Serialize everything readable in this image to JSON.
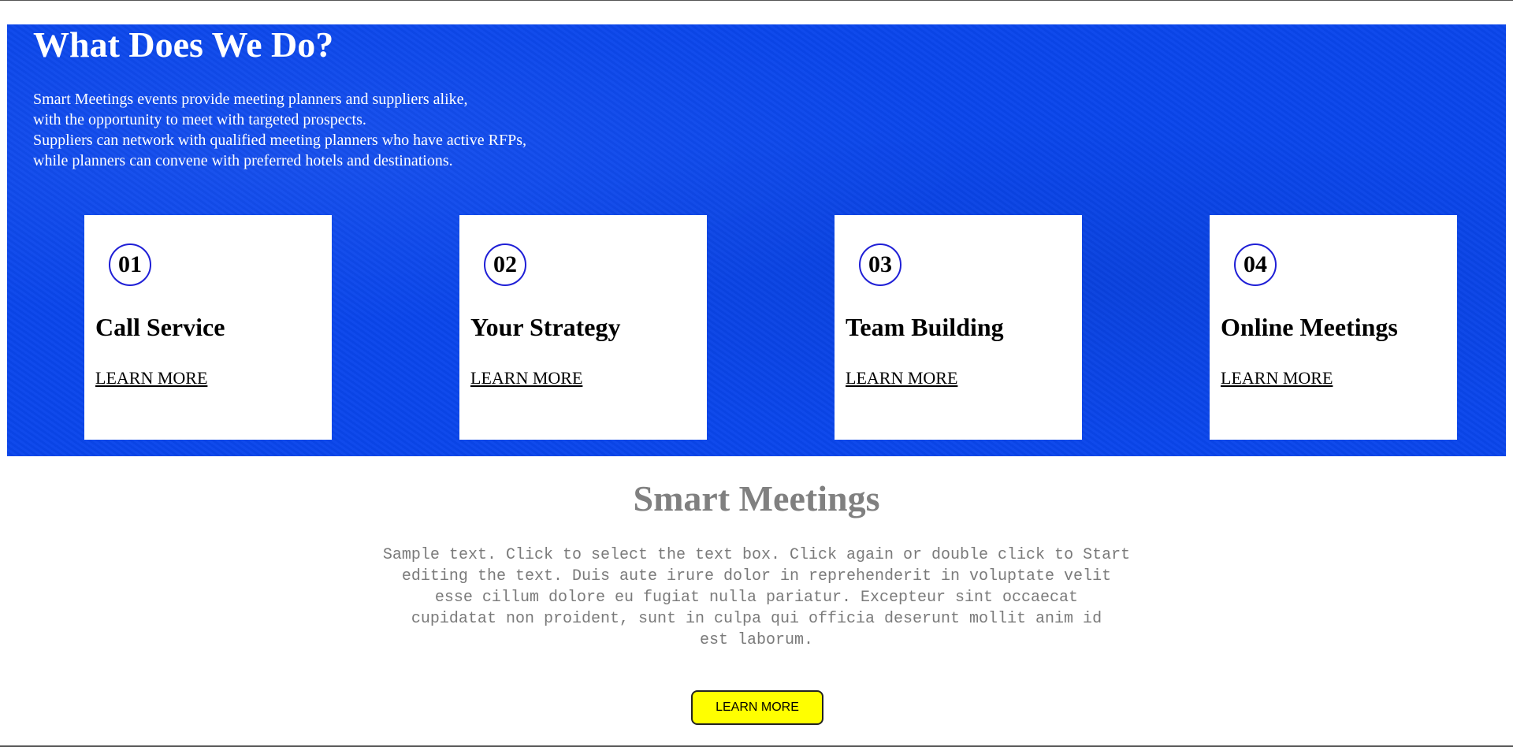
{
  "hero": {
    "title": "What Does We Do?",
    "text_lines": [
      "Smart Meetings events provide meeting planners and suppliers alike,",
      "with the opportunity to meet with targeted prospects.",
      "Suppliers can network with qualified meeting planners who have active RFPs,",
      "while planners can convene with preferred hotels and destinations."
    ],
    "background_color": "#0a46ec",
    "text_color": "#ffffff"
  },
  "cards": [
    {
      "number": "01",
      "title": "Call Service",
      "link": "LEARN MORE"
    },
    {
      "number": "02",
      "title": "Your Strategy",
      "link": "LEARN MORE"
    },
    {
      "number": "03",
      "title": "Team Building",
      "link": "LEARN MORE"
    },
    {
      "number": "04",
      "title": "Online Meetings",
      "link": "LEARN MORE"
    }
  ],
  "cards_style": {
    "number_circle_color": "#1f1fd6"
  },
  "section": {
    "title": "Smart Meetings",
    "text_lines": [
      "Sample text. Click to select the text box. Click again or double click to Start",
      "editing the text. Duis aute irure dolor in reprehenderit in voluptate velit",
      "esse cillum dolore eu fugiat nulla pariatur. Excepteur sint occaecat",
      "cupidatat non proident, sunt in culpa qui officia deserunt mollit anim id",
      "est laborum."
    ],
    "button_label": "LEARN MORE",
    "title_color": "#808080",
    "button_color": "#ffff00"
  }
}
